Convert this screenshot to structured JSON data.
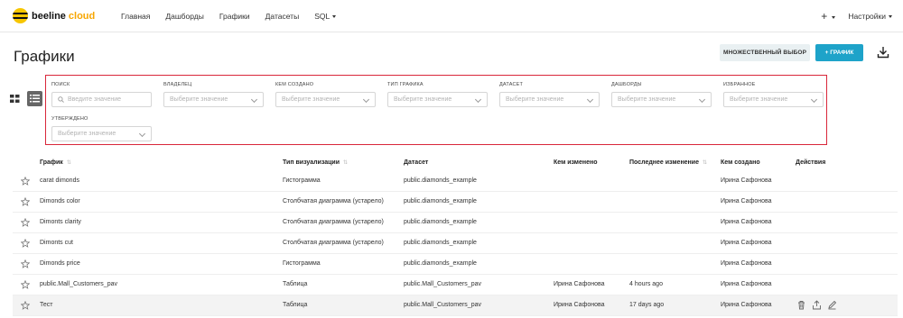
{
  "nav": {
    "brand": "beeline",
    "brand_suffix": "cloud",
    "links": [
      "Главная",
      "Дашборды",
      "Графики",
      "Датасеты",
      "SQL"
    ],
    "plus": "+",
    "settings": "Настройки"
  },
  "page": {
    "title": "Графики",
    "multi_select_label": "МНОЖЕСТВЕННЫЙ ВЫБОР",
    "add_chart_label": "+ ГРАФИК"
  },
  "filters": [
    {
      "label": "ПОИСК",
      "placeholder": "Введите значение",
      "type": "search"
    },
    {
      "label": "ВЛАДЕЛЕЦ",
      "placeholder": "Выберите значение",
      "type": "select"
    },
    {
      "label": "КЕМ СОЗДАНО",
      "placeholder": "Выберите значение",
      "type": "select"
    },
    {
      "label": "ТИП ГРАФИКА",
      "placeholder": "Выберите значение",
      "type": "select"
    },
    {
      "label": "ДАТАСЕТ",
      "placeholder": "Выберите значение",
      "type": "select"
    },
    {
      "label": "ДАШБОРДЫ",
      "placeholder": "Выберите значение",
      "type": "select"
    },
    {
      "label": "ИЗБРАННОЕ",
      "placeholder": "Выберите значение",
      "type": "select"
    },
    {
      "label": "УТВЕРЖДЕНО",
      "placeholder": "Выберите значение",
      "type": "select"
    }
  ],
  "table": {
    "columns": [
      "График",
      "Тип визуализации",
      "Датасет",
      "Кем изменено",
      "Последнее изменение",
      "Кем создано",
      "Действия"
    ],
    "rows": [
      {
        "name": "carat dimonds",
        "viz": "Гистограмма",
        "dataset": "public.diamonds_example",
        "modified_by": "",
        "modified": "",
        "created_by": "Ирина Сафонова"
      },
      {
        "name": "Dimonds color",
        "viz": "Столбчатая диаграмма (устарело)",
        "dataset": "public.diamonds_example",
        "modified_by": "",
        "modified": "",
        "created_by": "Ирина Сафонова"
      },
      {
        "name": "Dimonts clarity",
        "viz": "Столбчатая диаграмма (устарело)",
        "dataset": "public.diamonds_example",
        "modified_by": "",
        "modified": "",
        "created_by": "Ирина Сафонова"
      },
      {
        "name": "Dimonts cut",
        "viz": "Столбчатая диаграмма (устарело)",
        "dataset": "public.diamonds_example",
        "modified_by": "",
        "modified": "",
        "created_by": "Ирина Сафонова"
      },
      {
        "name": "Dimonds price",
        "viz": "Гистограмма",
        "dataset": "public.diamonds_example",
        "modified_by": "",
        "modified": "",
        "created_by": "Ирина Сафонова"
      },
      {
        "name": "public.Mall_Customers_pav",
        "viz": "Таблица",
        "dataset": "public.Mall_Customers_pav",
        "modified_by": "Ирина Сафонова",
        "modified": "4 hours ago",
        "created_by": "Ирина Сафонова"
      },
      {
        "name": "Тест",
        "viz": "Таблица",
        "dataset": "public.Mall_Customers_pav",
        "modified_by": "Ирина Сафонова",
        "modified": "17 days ago",
        "created_by": "Ирина Сафонова"
      }
    ]
  },
  "colors": {
    "accent": "#1ea3c9",
    "brand_yellow": "#f7c600",
    "filter_border": "#d9273a"
  }
}
